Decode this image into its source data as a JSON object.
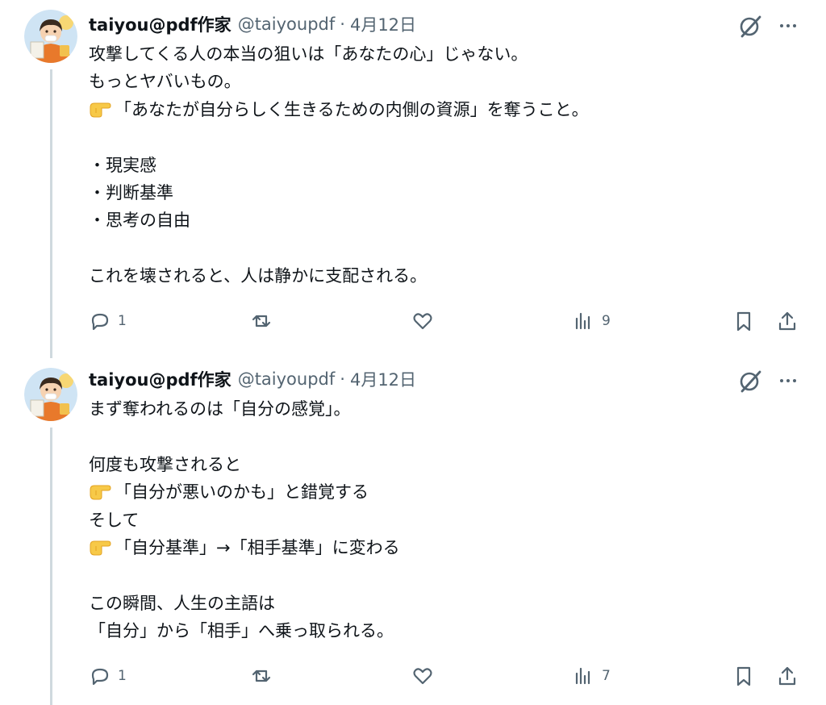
{
  "posts": [
    {
      "author_name": "taiyou@pdf作家",
      "handle": "@taiyoupdf",
      "separator": "·",
      "date": "4月12日",
      "lines": [
        {
          "pointer": false,
          "text": "攻撃してくる人の本当の狙いは「あなたの心」じゃない。"
        },
        {
          "pointer": false,
          "text": "もっとヤバいもの。"
        },
        {
          "pointer": true,
          "text": "「あなたが自分らしく生きるための内側の資源」を奪うこと。"
        },
        {
          "pointer": false,
          "text": ""
        },
        {
          "pointer": false,
          "text": "・現実感"
        },
        {
          "pointer": false,
          "text": "・判断基準"
        },
        {
          "pointer": false,
          "text": "・思考の自由"
        },
        {
          "pointer": false,
          "text": ""
        },
        {
          "pointer": false,
          "text": "これを壊されると、人は静かに支配される。"
        }
      ],
      "reply_count": "1",
      "repost_count": "",
      "like_count": "",
      "views_count": "9"
    },
    {
      "author_name": "taiyou@pdf作家",
      "handle": "@taiyoupdf",
      "separator": "·",
      "date": "4月12日",
      "lines": [
        {
          "pointer": false,
          "text": "まず奪われるのは「自分の感覚」。"
        },
        {
          "pointer": false,
          "text": ""
        },
        {
          "pointer": false,
          "text": "何度も攻撃されると"
        },
        {
          "pointer": true,
          "text": "「自分が悪いのかも」と錯覚する"
        },
        {
          "pointer": false,
          "text": "そして"
        },
        {
          "pointer": true,
          "text": "「自分基準」→「相手基準」に変わる"
        },
        {
          "pointer": false,
          "text": ""
        },
        {
          "pointer": false,
          "text": "この瞬間、人生の主語は"
        },
        {
          "pointer": false,
          "text": "「自分」から「相手」へ乗っ取られる。"
        }
      ],
      "reply_count": "1",
      "repost_count": "",
      "like_count": "",
      "views_count": "7"
    }
  ],
  "icons": {
    "grok": "grok-icon",
    "more": "more-icon",
    "reply": "reply-icon",
    "repost": "repost-icon",
    "like": "like-icon",
    "views": "views-icon",
    "bookmark": "bookmark-icon",
    "share": "share-icon",
    "pointer": "backhand-index-pointing-right-emoji"
  },
  "colors": {
    "text_primary": "#0f1419",
    "text_secondary": "#536471",
    "thread_line": "#cfd9de",
    "background": "#ffffff",
    "avatar_accent": "#e8792b"
  }
}
